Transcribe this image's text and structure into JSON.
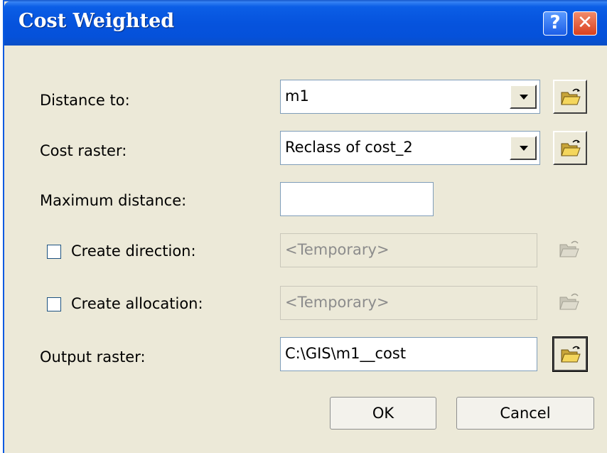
{
  "window": {
    "title": "Cost Weighted"
  },
  "titlebar": {
    "help_label": "?",
    "close_label": "✕"
  },
  "fields": {
    "distance_to": {
      "label": "Distance to:",
      "value": "m1"
    },
    "cost_raster": {
      "label": "Cost raster:",
      "value": "Reclass of cost_2"
    },
    "maximum_distance": {
      "label": "Maximum distance:",
      "value": ""
    },
    "create_direction": {
      "label": "Create direction:",
      "checked": false,
      "value": "<Temporary>"
    },
    "create_allocation": {
      "label": "Create allocation:",
      "checked": false,
      "value": "<Temporary>"
    },
    "output_raster": {
      "label": "Output raster:",
      "value": "C:\\GIS\\m1__cost"
    }
  },
  "buttons": {
    "ok": "OK",
    "cancel": "Cancel"
  },
  "icons": {
    "browse": "open-folder-icon",
    "dropdown": "chevron-down-icon"
  }
}
